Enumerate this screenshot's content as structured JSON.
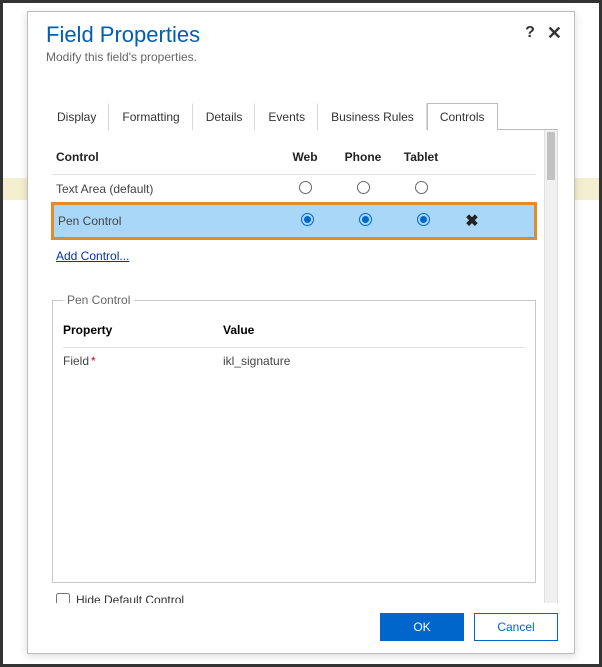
{
  "header": {
    "title": "Field Properties",
    "subtitle": "Modify this field's properties.",
    "help_symbol": "?",
    "close_symbol": "✕"
  },
  "tabs": {
    "items": [
      {
        "label": "Display"
      },
      {
        "label": "Formatting"
      },
      {
        "label": "Details"
      },
      {
        "label": "Events"
      },
      {
        "label": "Business Rules"
      },
      {
        "label": "Controls"
      }
    ],
    "activeIndex": 5
  },
  "controls_table": {
    "columns": {
      "name": "Control",
      "web": "Web",
      "phone": "Phone",
      "tablet": "Tablet"
    },
    "rows": [
      {
        "name": "Text Area (default)",
        "web": false,
        "phone": false,
        "tablet": false,
        "removable": false
      },
      {
        "name": "Pen Control",
        "web": true,
        "phone": true,
        "tablet": true,
        "removable": true,
        "highlighted": true
      }
    ],
    "add_link": "Add Control...",
    "remove_symbol": "✖"
  },
  "pen_section": {
    "legend": "Pen Control",
    "columns": {
      "property": "Property",
      "value": "Value"
    },
    "rows": [
      {
        "property": "Field",
        "required": true,
        "value": "ikl_signature"
      }
    ]
  },
  "hide_default": {
    "label": "Hide Default Control",
    "checked": false
  },
  "footer": {
    "ok": "OK",
    "cancel": "Cancel"
  }
}
